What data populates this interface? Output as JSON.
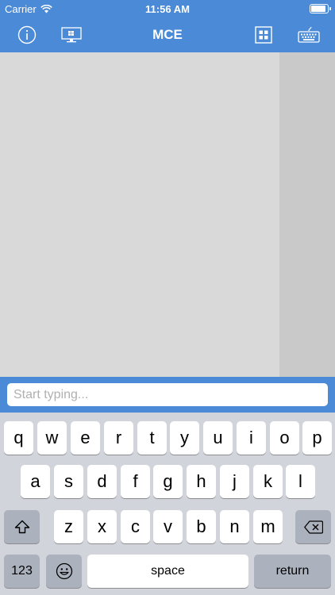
{
  "status_bar": {
    "carrier": "Carrier",
    "time": "11:56 AM"
  },
  "nav_bar": {
    "title": "MCE",
    "left_icons": [
      "info-icon",
      "remote-desktop-icon"
    ],
    "right_icons": [
      "grid-icon",
      "keyboard-icon"
    ]
  },
  "input": {
    "placeholder": "Start typing..."
  },
  "keyboard": {
    "row1": [
      "q",
      "w",
      "e",
      "r",
      "t",
      "y",
      "u",
      "i",
      "o",
      "p"
    ],
    "row2": [
      "a",
      "s",
      "d",
      "f",
      "g",
      "h",
      "j",
      "k",
      "l"
    ],
    "row3": [
      "z",
      "x",
      "c",
      "v",
      "b",
      "n",
      "m"
    ],
    "numbers_label": "123",
    "space_label": "space",
    "return_label": "return"
  },
  "colors": {
    "accent": "#4a8ad6",
    "keyboard_bg": "#d1d4da",
    "content_bg": "#d9d9d9",
    "side_panel": "#c9c9c9"
  }
}
